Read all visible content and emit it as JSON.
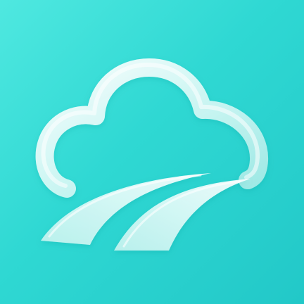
{
  "app_icon": {
    "icon_name": "cloud-road-icon",
    "colors": {
      "background_light": "#4fe8e0",
      "background_mid": "#2fd8d3",
      "background_dark": "#22c8c8",
      "glass_fill": "#c9f7f4",
      "glass_highlight": "#ffffff",
      "glass_edge": "#8fe6e2"
    }
  }
}
